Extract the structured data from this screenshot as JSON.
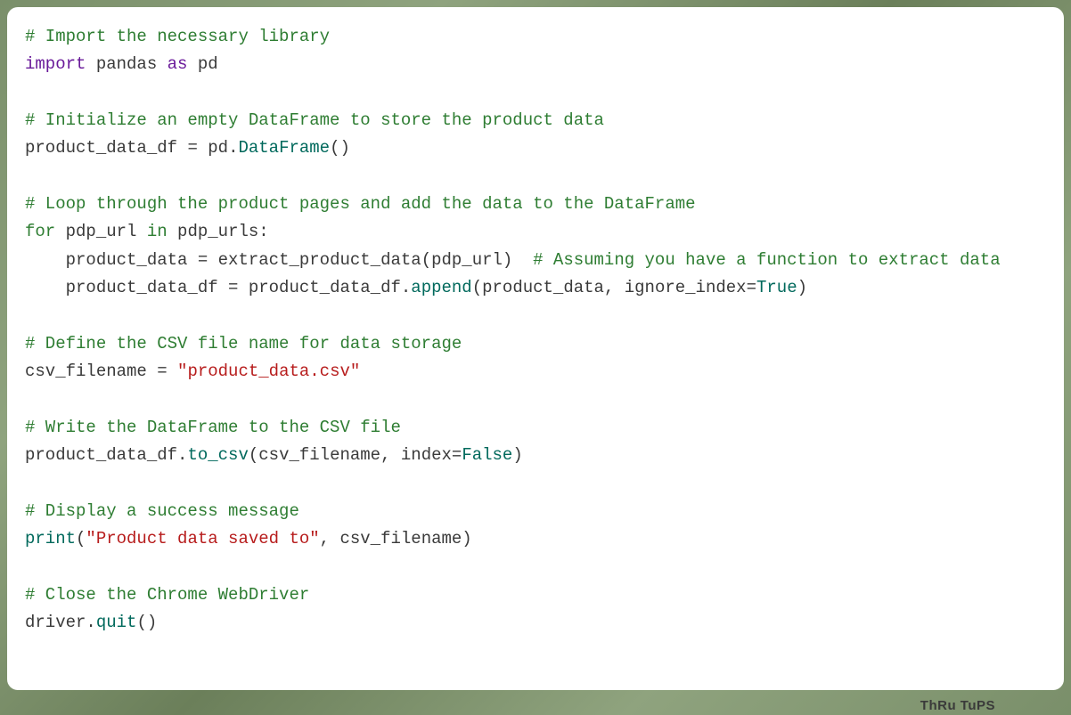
{
  "code": {
    "line1_comment": "# Import the necessary library",
    "line2_keyword1": "import",
    "line2_text1": " pandas ",
    "line2_keyword2": "as",
    "line2_text2": " pd",
    "line4_comment": "# Initialize an empty DataFrame to store the product data",
    "line5_text1": "product_data_df ",
    "line5_op": "=",
    "line5_text2": " pd",
    "line5_dot": ".",
    "line5_func": "DataFrame",
    "line5_text3": "()",
    "line7_comment": "# Loop through the product pages and add the data to the DataFrame",
    "line8_keyword1": "for",
    "line8_text1": " pdp_url ",
    "line8_keyword2": "in",
    "line8_text2": " pdp_urls:",
    "line9_text1": "    product_data ",
    "line9_op": "=",
    "line9_text2": " extract_product_data(pdp_url)  ",
    "line9_comment": "# Assuming you have a function to extract data",
    "line10_text1": "    product_data_df ",
    "line10_op": "=",
    "line10_text2": " product_data_df",
    "line10_dot": ".",
    "line10_func": "append",
    "line10_text3": "(product_data, ignore_index",
    "line10_op2": "=",
    "line10_const": "True",
    "line10_text4": ")",
    "line12_comment": "# Define the CSV file name for data storage",
    "line13_text1": "csv_filename ",
    "line13_op": "=",
    "line13_text2": " ",
    "line13_string": "\"product_data.csv\"",
    "line15_comment": "# Write the DataFrame to the CSV file",
    "line16_text1": "product_data_df",
    "line16_dot": ".",
    "line16_func": "to_csv",
    "line16_text2": "(csv_filename, index",
    "line16_op": "=",
    "line16_const": "False",
    "line16_text3": ")",
    "line18_comment": "# Display a success message",
    "line19_builtin": "print",
    "line19_text1": "(",
    "line19_string": "\"Product data saved to\"",
    "line19_text2": ", csv_filename)",
    "line21_comment": "# Close the Chrome WebDriver",
    "line22_text1": "driver",
    "line22_dot": ".",
    "line22_func": "quit",
    "line22_text2": "()"
  },
  "footer": "ThRu TuPS"
}
